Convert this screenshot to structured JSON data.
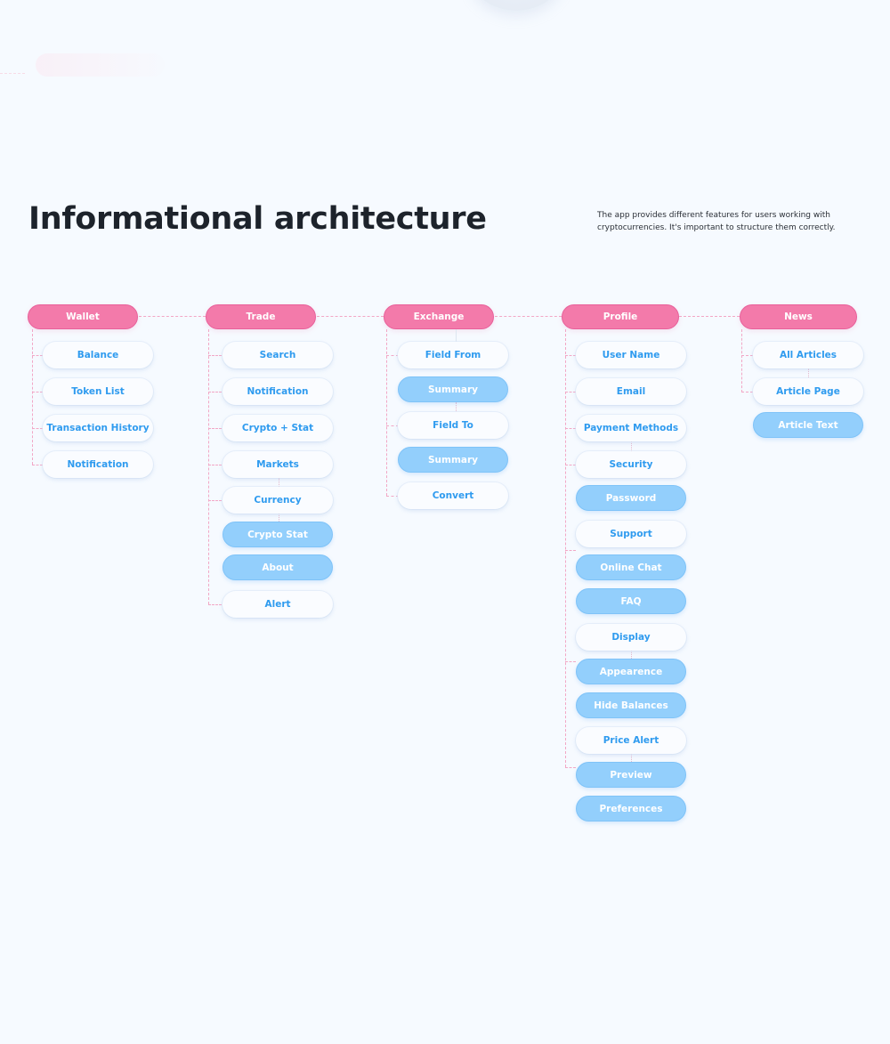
{
  "header": {
    "title": "Informational architecture",
    "description": "The app provides different features for users working with cryptocurrencies. It's important to structure them correctly."
  },
  "colors": {
    "background": "#f6faff",
    "section_fill": "#f37aaa",
    "section_border": "#e8609a",
    "screen_text": "#2f9bef",
    "subscreen_fill": "#93cffc",
    "connector": "#f2a7c6",
    "title_text": "#1d232b"
  },
  "legend_types": {
    "section": "pink section header",
    "screen": "white screen node",
    "sub": "blue sub-screen node"
  },
  "sections": [
    {
      "label": "Wallet",
      "nodes": [
        {
          "label": "Balance",
          "type": "screen"
        },
        {
          "label": "Token List",
          "type": "screen"
        },
        {
          "label": "Transaction History",
          "type": "screen"
        },
        {
          "label": "Notification",
          "type": "screen"
        }
      ]
    },
    {
      "label": "Trade",
      "nodes": [
        {
          "label": "Search",
          "type": "screen"
        },
        {
          "label": "Notification",
          "type": "screen"
        },
        {
          "label": "Crypto + Stat",
          "type": "screen"
        },
        {
          "label": "Markets",
          "type": "screen"
        },
        {
          "label": "Currency",
          "type": "screen"
        },
        {
          "label": "Crypto Stat",
          "type": "sub"
        },
        {
          "label": "About",
          "type": "sub"
        },
        {
          "label": "Alert",
          "type": "screen"
        }
      ]
    },
    {
      "label": "Exchange",
      "nodes": [
        {
          "label": "Field From",
          "type": "screen"
        },
        {
          "label": "Summary",
          "type": "sub"
        },
        {
          "label": "Field To",
          "type": "screen"
        },
        {
          "label": "Summary",
          "type": "sub"
        },
        {
          "label": "Convert",
          "type": "screen"
        }
      ]
    },
    {
      "label": "Profile",
      "nodes": [
        {
          "label": "User Name",
          "type": "screen"
        },
        {
          "label": "Email",
          "type": "screen"
        },
        {
          "label": "Payment Methods",
          "type": "screen"
        },
        {
          "label": "Security",
          "type": "screen"
        },
        {
          "label": "Password",
          "type": "sub"
        },
        {
          "label": "Support",
          "type": "screen"
        },
        {
          "label": "Online Chat",
          "type": "sub"
        },
        {
          "label": "FAQ",
          "type": "sub"
        },
        {
          "label": "Display",
          "type": "screen"
        },
        {
          "label": "Appearence",
          "type": "sub"
        },
        {
          "label": "Hide Balances",
          "type": "sub"
        },
        {
          "label": "Price Alert",
          "type": "screen"
        },
        {
          "label": "Preview",
          "type": "sub"
        },
        {
          "label": "Preferences",
          "type": "sub"
        }
      ]
    },
    {
      "label": "News",
      "nodes": [
        {
          "label": "All Articles",
          "type": "screen"
        },
        {
          "label": "Article Page",
          "type": "screen"
        },
        {
          "label": "Article Text",
          "type": "sub"
        }
      ]
    }
  ]
}
